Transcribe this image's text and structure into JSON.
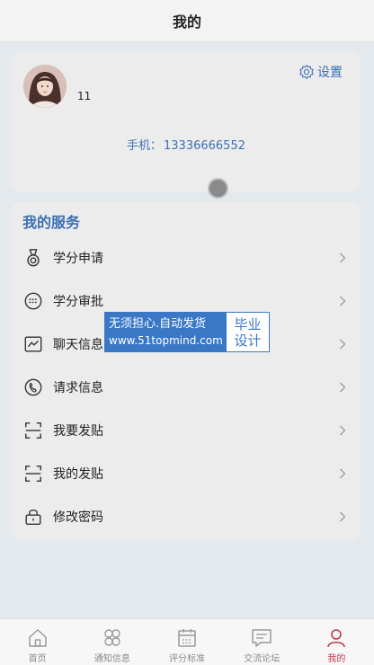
{
  "header": {
    "title": "我的"
  },
  "profile": {
    "username": "11",
    "settings_label": "设置",
    "phone_label": "手机：",
    "phone_number": "13336666552"
  },
  "services": {
    "title": "我的服务",
    "items": [
      {
        "label": "学分申请",
        "icon": "medal-icon"
      },
      {
        "label": "学分审批",
        "icon": "keyboard-icon"
      },
      {
        "label": "聊天信息",
        "icon": "chart-icon"
      },
      {
        "label": "请求信息",
        "icon": "phone-icon"
      },
      {
        "label": "我要发贴",
        "icon": "scan-icon"
      },
      {
        "label": "我的发贴",
        "icon": "scan-icon"
      },
      {
        "label": "修改密码",
        "icon": "lock-icon"
      }
    ]
  },
  "watermark": {
    "line1": "无须担心.自动发货",
    "line2": "www.51topmind.com",
    "right1": "毕业",
    "right2": "设计"
  },
  "tabbar": {
    "items": [
      {
        "label": "首页",
        "icon": "home-icon"
      },
      {
        "label": "通知信息",
        "icon": "grid-icon"
      },
      {
        "label": "评分标准",
        "icon": "calendar-icon"
      },
      {
        "label": "交流论坛",
        "icon": "message-icon"
      },
      {
        "label": "我的",
        "icon": "user-icon",
        "active": true
      }
    ]
  },
  "colors": {
    "accent": "#3a6fb5",
    "active_tab": "#c0394b",
    "background": "#e3e9ec",
    "card": "#ececec"
  }
}
